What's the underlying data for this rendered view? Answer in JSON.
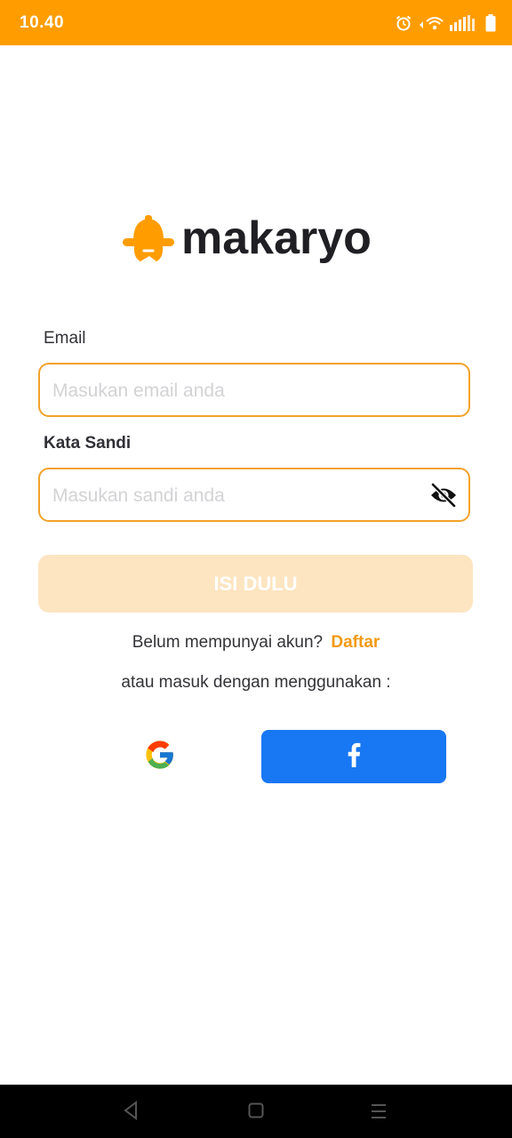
{
  "status_bar": {
    "time": "10.40",
    "icons": [
      "alarm-icon",
      "wifi-icon",
      "signal-icon",
      "battery-icon"
    ]
  },
  "brand": {
    "name": "makaryo",
    "accent_color": "#FF9D00"
  },
  "form": {
    "email_label": "Email",
    "email_placeholder": "Masukan email anda",
    "email_value": "",
    "password_label": "Kata Sandi",
    "password_placeholder": "Masukan sandi anda",
    "password_value": "",
    "submit_label": "ISI DULU"
  },
  "register": {
    "prompt": "Belum mempunyai akun?",
    "link": "Daftar"
  },
  "social": {
    "prompt": "atau masuk dengan menggunakan :",
    "google_icon": "google-icon",
    "facebook_icon": "facebook-icon",
    "facebook_color": "#1877F2"
  },
  "nav_bar": {
    "buttons": [
      "back-icon",
      "home-icon",
      "menu-icon"
    ]
  }
}
